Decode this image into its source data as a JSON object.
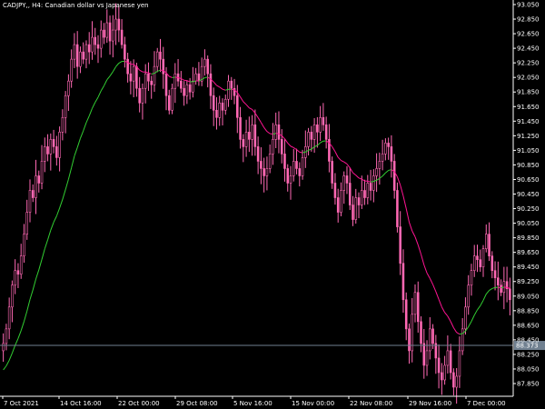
{
  "chart_data": {
    "type": "candlestick",
    "title": "CADJPY,, H4:  Canadian dollar vs Japanese yen",
    "ylim": [
      87.65,
      93.05
    ],
    "y_ticks": [
      "93.050",
      "92.850",
      "92.650",
      "92.450",
      "92.250",
      "92.050",
      "91.850",
      "91.650",
      "91.450",
      "91.250",
      "91.050",
      "90.850",
      "90.650",
      "90.450",
      "90.250",
      "90.050",
      "89.850",
      "89.650",
      "89.450",
      "89.250",
      "89.050",
      "88.850",
      "88.650",
      "88.450",
      "88.250",
      "88.050",
      "87.850"
    ],
    "x_ticks": [
      "7 Oct 2021",
      "14 Oct 16:00",
      "22 Oct 00:00",
      "29 Oct 08:00",
      "5 Nov 16:00",
      "15 Nov 00:00",
      "22 Nov 08:00",
      "29 Nov 16:00",
      "7 Dec 00:00"
    ],
    "current_price": "88.373",
    "colors": {
      "background": "#000000",
      "candle": "#ff69b4",
      "ma_up": "#32cd32",
      "ma_down": "#ff1493",
      "axis": "#ffffff",
      "price_label_bg": "#708090",
      "price_line": "#708090"
    },
    "closes": [
      88.4,
      88.6,
      88.9,
      89.2,
      89.4,
      89.35,
      89.6,
      89.9,
      90.2,
      90.5,
      90.4,
      90.7,
      90.6,
      90.9,
      91.1,
      91.0,
      91.2,
      91.1,
      90.95,
      91.3,
      91.5,
      91.8,
      92.0,
      92.3,
      92.5,
      92.2,
      92.4,
      92.3,
      92.5,
      92.4,
      92.6,
      92.5,
      92.45,
      92.7,
      92.6,
      92.8,
      92.55,
      92.7,
      92.85,
      92.7,
      92.5,
      92.3,
      92.1,
      92.0,
      92.2,
      91.9,
      91.7,
      91.9,
      92.1,
      92.0,
      91.95,
      92.2,
      92.4,
      92.3,
      92.1,
      91.8,
      91.6,
      91.9,
      92.1,
      92.0,
      91.9,
      91.8,
      91.95,
      91.85,
      92.0,
      92.1,
      92.0,
      92.2,
      92.3,
      92.1,
      91.8,
      91.6,
      91.5,
      91.7,
      91.6,
      91.75,
      92.0,
      91.9,
      91.8,
      91.5,
      91.2,
      91.1,
      91.3,
      91.2,
      91.4,
      91.1,
      90.9,
      90.8,
      90.7,
      90.8,
      91.0,
      91.2,
      91.4,
      91.2,
      91.0,
      90.8,
      90.6,
      90.7,
      90.9,
      90.8,
      90.7,
      90.95,
      91.1,
      91.3,
      91.2,
      91.4,
      91.3,
      91.5,
      91.4,
      91.2,
      90.9,
      90.6,
      90.4,
      90.2,
      90.5,
      90.7,
      90.6,
      90.3,
      90.1,
      90.4,
      90.3,
      90.5,
      90.4,
      90.6,
      90.5,
      90.7,
      90.8,
      90.9,
      91.0,
      91.15,
      91.1,
      90.9,
      90.5,
      90.0,
      89.5,
      89.0,
      88.6,
      88.3,
      88.8,
      89.1,
      88.7,
      88.4,
      88.1,
      88.3,
      88.6,
      88.4,
      88.2,
      88.0,
      87.9,
      88.1,
      88.3,
      88.0,
      87.8,
      87.95,
      88.3,
      88.6,
      88.9,
      89.2,
      89.4,
      89.6,
      89.55,
      89.45,
      89.7,
      89.9,
      89.6,
      89.4,
      89.3,
      89.2,
      89.1,
      89.25,
      89.15,
      89.0
    ]
  }
}
